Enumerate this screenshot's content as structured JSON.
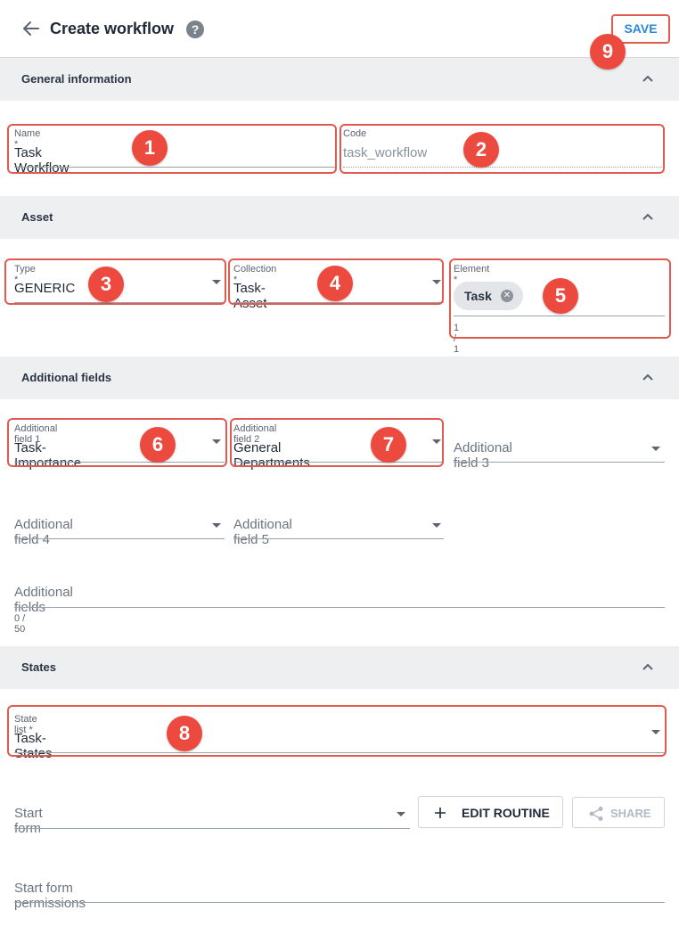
{
  "header": {
    "title": "Create workflow",
    "help_icon": "?",
    "save_label": "SAVE"
  },
  "sections": {
    "general": "General information",
    "asset": "Asset",
    "additional": "Additional fields",
    "states": "States"
  },
  "general": {
    "name": {
      "label": "Name *",
      "value": "Task Workflow"
    },
    "code": {
      "label": "Code",
      "placeholder": "task_workflow"
    }
  },
  "asset": {
    "type": {
      "label": "Type *",
      "value": "GENERIC"
    },
    "collection": {
      "label": "Collection *",
      "value": "Task-Asset"
    },
    "element": {
      "label": "Element *",
      "chip": "Task",
      "counter": "1 / 1"
    }
  },
  "additional": {
    "field1": {
      "label": "Additional field 1",
      "value": "Task-Importance"
    },
    "field2": {
      "label": "Additional field 2",
      "value": "General Departments"
    },
    "field3": {
      "placeholder": "Additional field 3"
    },
    "field4": {
      "placeholder": "Additional field 4"
    },
    "field5": {
      "placeholder": "Additional field 5"
    },
    "fields": {
      "placeholder": "Additional fields",
      "counter": "0 / 50"
    }
  },
  "states": {
    "state_list": {
      "label": "State list *",
      "value": "Task-States"
    },
    "start_form": {
      "placeholder": "Start form"
    },
    "edit_routine_label": "EDIT ROUTINE",
    "share_label": "SHARE",
    "start_form_permissions": {
      "placeholder": "Start form permissions"
    }
  },
  "annotations": [
    "1",
    "2",
    "3",
    "4",
    "5",
    "6",
    "7",
    "8",
    "9"
  ],
  "colors": {
    "accent": "#2b86d9",
    "annotation": "#ec4a3f",
    "section_bg": "#eeeff1"
  }
}
